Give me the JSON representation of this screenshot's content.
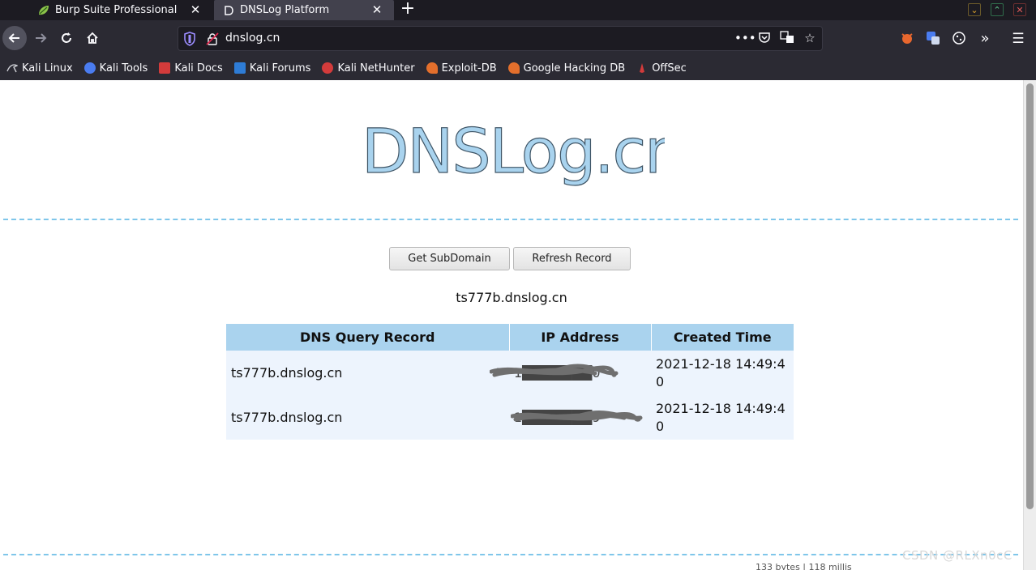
{
  "tabs": [
    {
      "title": "Burp Suite Professional",
      "active": false,
      "icon": "burp-icon"
    },
    {
      "title": "DNSLog Platform",
      "active": true,
      "icon": "dnslog-icon"
    }
  ],
  "toolbar": {
    "url": "dnslog.cn",
    "page_actions_icon": "•••"
  },
  "bookmarks": [
    {
      "label": "Kali Linux",
      "color": "#9aa0a6"
    },
    {
      "label": "Kali Tools",
      "color": "#4a7cf0"
    },
    {
      "label": "Kali Docs",
      "color": "#d33b3b"
    },
    {
      "label": "Kali Forums",
      "color": "#2e7cd6"
    },
    {
      "label": "Kali NetHunter",
      "color": "#d33b3b"
    },
    {
      "label": "Exploit-DB",
      "color": "#e36f2c"
    },
    {
      "label": "Google Hacking DB",
      "color": "#e36f2c"
    },
    {
      "label": "OffSec",
      "color": "#d33b3b"
    }
  ],
  "page": {
    "logo_text": "DNSLog.cn",
    "get_subdomain_label": "Get SubDomain",
    "refresh_record_label": "Refresh Record",
    "subdomain": "ts777b.dnslog.cn",
    "table": {
      "headers": [
        "DNS Query Record",
        "IP Address",
        "Created Time"
      ],
      "rows": [
        {
          "record": "ts777b.dnslog.cn",
          "ip": "1███████0",
          "time": "2021-12-18 14:49:4\n0"
        },
        {
          "record": "ts777b.dnslog.cn",
          "ip": "1███████9",
          "time": "2021-12-18 14:49:4\n0"
        }
      ]
    },
    "footer_partial": "133 bytes | 118 millis"
  },
  "watermark": "CSDN @RLXn0cC",
  "colors": {
    "accent_blue": "#aad3ee",
    "row_bg": "#edf4fd",
    "dash": "#7fc6ea"
  }
}
